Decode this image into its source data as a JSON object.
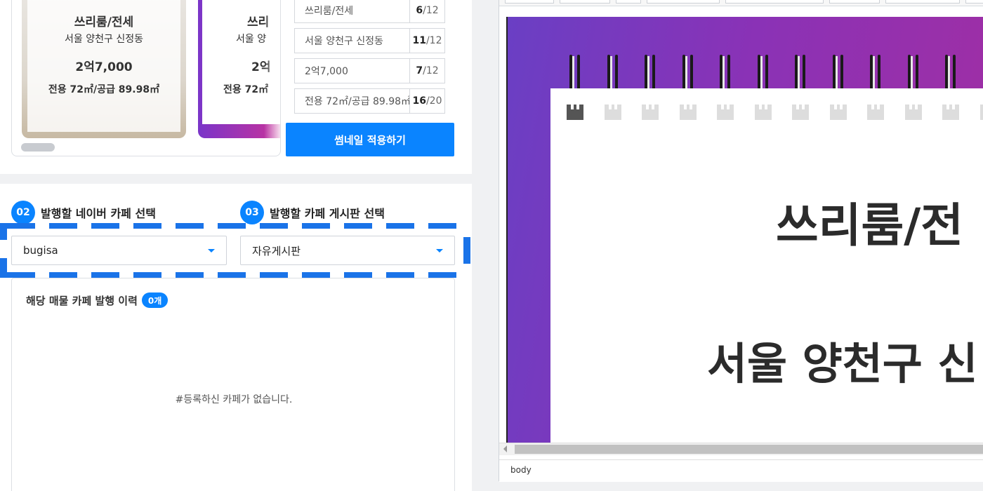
{
  "thumbnail": {
    "title": "쓰리룸/전세",
    "address": "서울 양천구 신정동",
    "price": "2억7,000",
    "area": "전용 72㎡/공급 89.98㎡",
    "second": {
      "title": "쓰리",
      "address": "서울 양",
      "price": "2억",
      "area": "전용 72㎡"
    }
  },
  "fields": [
    {
      "value": "쓰리룸/전세",
      "count": "6",
      "max": "/12"
    },
    {
      "value": "서울 양천구 신정동",
      "count": "11",
      "max": "/12"
    },
    {
      "value": "2억7,000",
      "count": "7",
      "max": "/12"
    },
    {
      "value": "전용 72㎡/공급 89.98㎡",
      "count": "16",
      "max": "/20"
    }
  ],
  "apply_button": "썸네일 적용하기",
  "steps": [
    {
      "num": "02",
      "label": "발행할 네이버 카페 선택"
    },
    {
      "num": "03",
      "label": "발행할 카페 게시판 선택"
    }
  ],
  "cafe_select": {
    "value": "bugisa"
  },
  "board_select": {
    "value": "자유게시판"
  },
  "history": {
    "title": "해당 매물 카페 발행 이력",
    "badge": "0개",
    "empty": "#등록하신 카페가 없습니다."
  },
  "editor": {
    "heading": "쓰리룸/전",
    "subheading": "서울 양천구 신",
    "status": "body"
  },
  "colors": {
    "accent": "#0a84ff",
    "gradient_start": "#6a3fc4",
    "gradient_end": "#a22ea2"
  }
}
